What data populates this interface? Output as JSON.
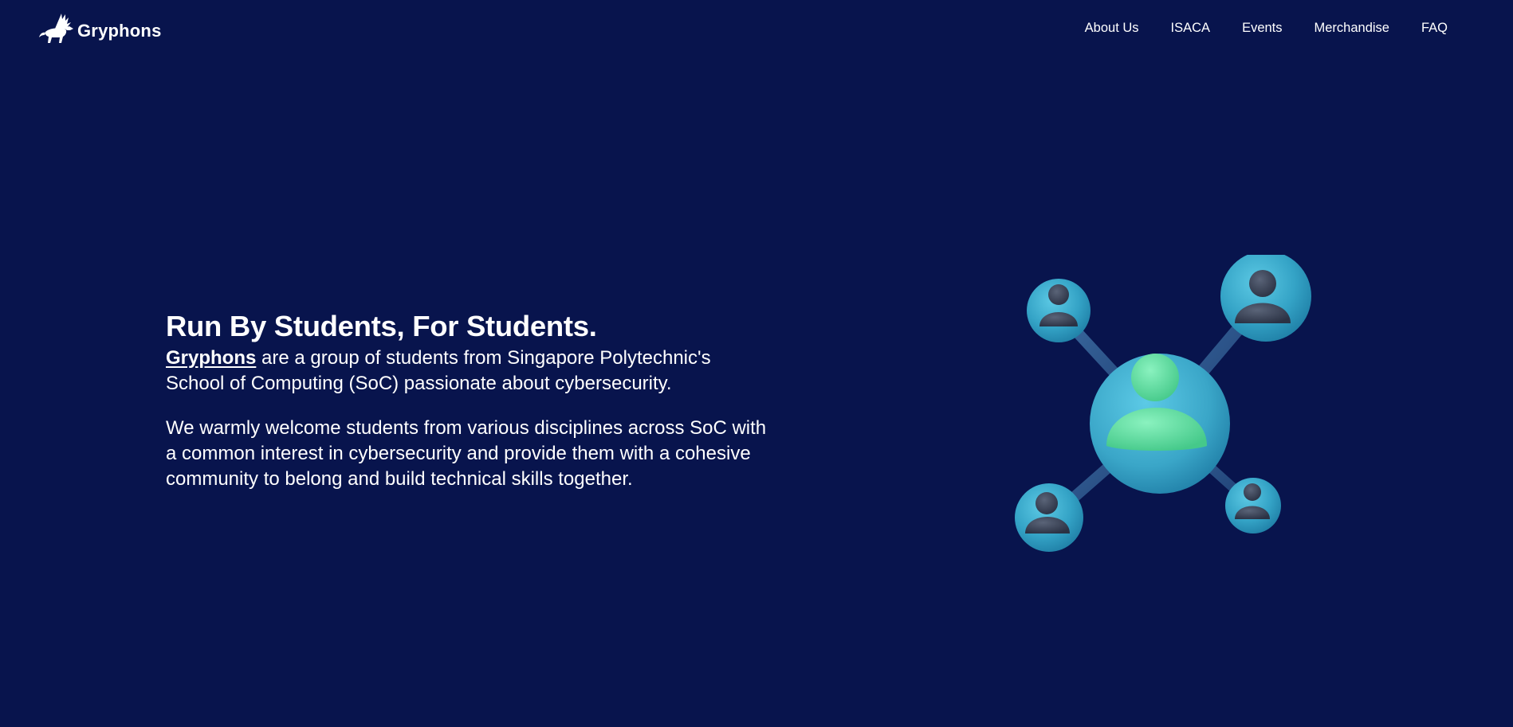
{
  "header": {
    "logo_text": "Gryphons",
    "logo_icon": "gryphon-icon",
    "nav": [
      {
        "label": "About Us"
      },
      {
        "label": "ISACA"
      },
      {
        "label": "Events"
      },
      {
        "label": "Merchandise"
      },
      {
        "label": "FAQ"
      }
    ]
  },
  "hero": {
    "title": "Run By Students, For Students.",
    "paragraph1": {
      "link_text": "Gryphons",
      "text": " are a group of students from Singapore Polytechnic's School of Computing (SoC) passionate about cybersecurity."
    },
    "paragraph2": "We warmly welcome students from various disciplines across SoC with a common interest in cybersecurity and provide them with a cohesive community to belong and build technical skills together.",
    "illustration_icon": "community-network-icon"
  },
  "colors": {
    "background": "#08144d",
    "text": "#ffffff",
    "node_blue": "#3aa8c8",
    "node_center_person": "#5fe0a0",
    "node_person": "#3a4356"
  }
}
